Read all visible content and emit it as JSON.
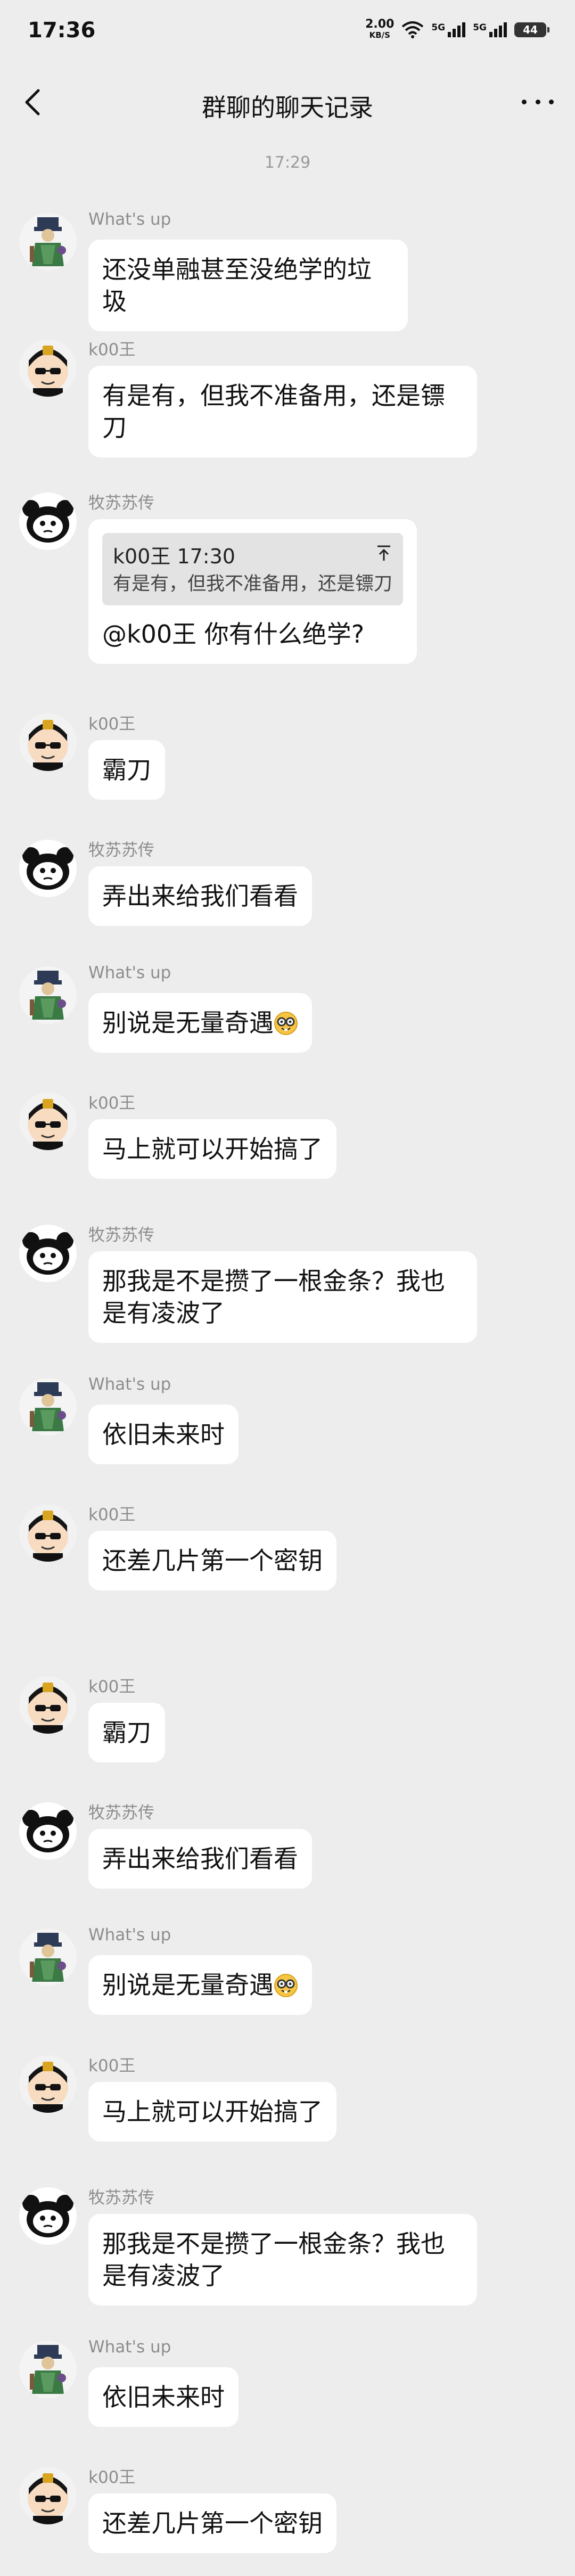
{
  "status_bar": {
    "time": "17:36",
    "net_speed": "2.00",
    "net_unit": "KB/S",
    "signal1": "5G",
    "signal2": "5G",
    "battery": "44"
  },
  "nav": {
    "title": "群聊的聊天记录"
  },
  "timestamp": "17:29",
  "senders": {
    "a": "What's up",
    "b": "k00王",
    "c": "牧苏苏传"
  },
  "messages": [
    {
      "sender": "What's up",
      "avatar": "whatsup-avatar",
      "text": "还没单融甚至没绝学的垃圾"
    },
    {
      "sender": "k00王",
      "avatar": "k00-avatar",
      "text": "有是有，但我不准备用，还是镖刀"
    },
    {
      "sender": "牧苏苏传",
      "avatar": "panda-avatar",
      "quote_meta": "k00王 17:30",
      "quote_text": "有是有，但我不准备用，还是镖刀",
      "text": "@k00王 你有什么绝学?"
    },
    {
      "sender": "k00王",
      "avatar": "k00-avatar",
      "text": "霸刀"
    },
    {
      "sender": "牧苏苏传",
      "avatar": "panda-avatar",
      "text": "弄出来给我们看看"
    },
    {
      "sender": "What's up",
      "avatar": "whatsup-avatar",
      "text": "别说是无量奇遇",
      "emoji": "nerd-face-icon"
    },
    {
      "sender": "k00王",
      "avatar": "k00-avatar",
      "text": "马上就可以开始搞了"
    },
    {
      "sender": "牧苏苏传",
      "avatar": "panda-avatar",
      "text": "那我是不是攒了一根金条？我也是有凌波了"
    },
    {
      "sender": "What's up",
      "avatar": "whatsup-avatar",
      "text": "依旧未来时"
    },
    {
      "sender": "k00王",
      "avatar": "k00-avatar",
      "text": "还差几片第一个密钥"
    },
    {
      "sender": "k00王",
      "avatar": "k00-avatar",
      "text": "霸刀"
    },
    {
      "sender": "牧苏苏传",
      "avatar": "panda-avatar",
      "text": "弄出来给我们看看"
    },
    {
      "sender": "What's up",
      "avatar": "whatsup-avatar",
      "text": "别说是无量奇遇",
      "emoji": "nerd-face-icon"
    },
    {
      "sender": "k00王",
      "avatar": "k00-avatar",
      "text": "马上就可以开始搞了"
    },
    {
      "sender": "牧苏苏传",
      "avatar": "panda-avatar",
      "text": "那我是不是攒了一根金条？我也是有凌波了"
    },
    {
      "sender": "What's up",
      "avatar": "whatsup-avatar",
      "text": "依旧未来时"
    },
    {
      "sender": "k00王",
      "avatar": "k00-avatar",
      "text": "还差几片第一个密钥"
    }
  ]
}
